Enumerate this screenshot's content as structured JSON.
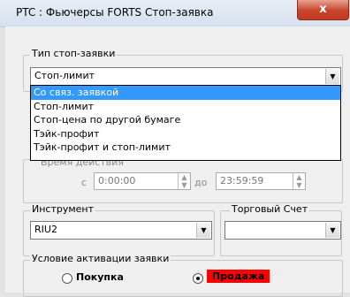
{
  "window": {
    "title": "PTC : Фьючерсы FORTS Стоп-заявка",
    "close_label": "x"
  },
  "stop_type": {
    "group_label": "Тип стоп-заявки",
    "selected": "Стоп-лимит",
    "options": [
      "Со связ. заявкой",
      "Стоп-лимит",
      "Стоп-цена по другой бумаге",
      "Тэйк-профит",
      "Тэйк-профит и стоп-лимит"
    ],
    "highlighted_index": 0
  },
  "time": {
    "label": "Время действия",
    "from_prefix": "с",
    "from_value": "0:00:00",
    "to_prefix": "до",
    "to_value": "23:59:59"
  },
  "instrument": {
    "group_label": "Инструмент",
    "value": "RIU2"
  },
  "account": {
    "group_label": "Торговый Счет",
    "value": ""
  },
  "activation": {
    "group_label": "Условие активации заявки",
    "buy_label": "Покупка",
    "sell_label": "Продажа",
    "selected": "sell",
    "sell_color": "#ff0000"
  }
}
